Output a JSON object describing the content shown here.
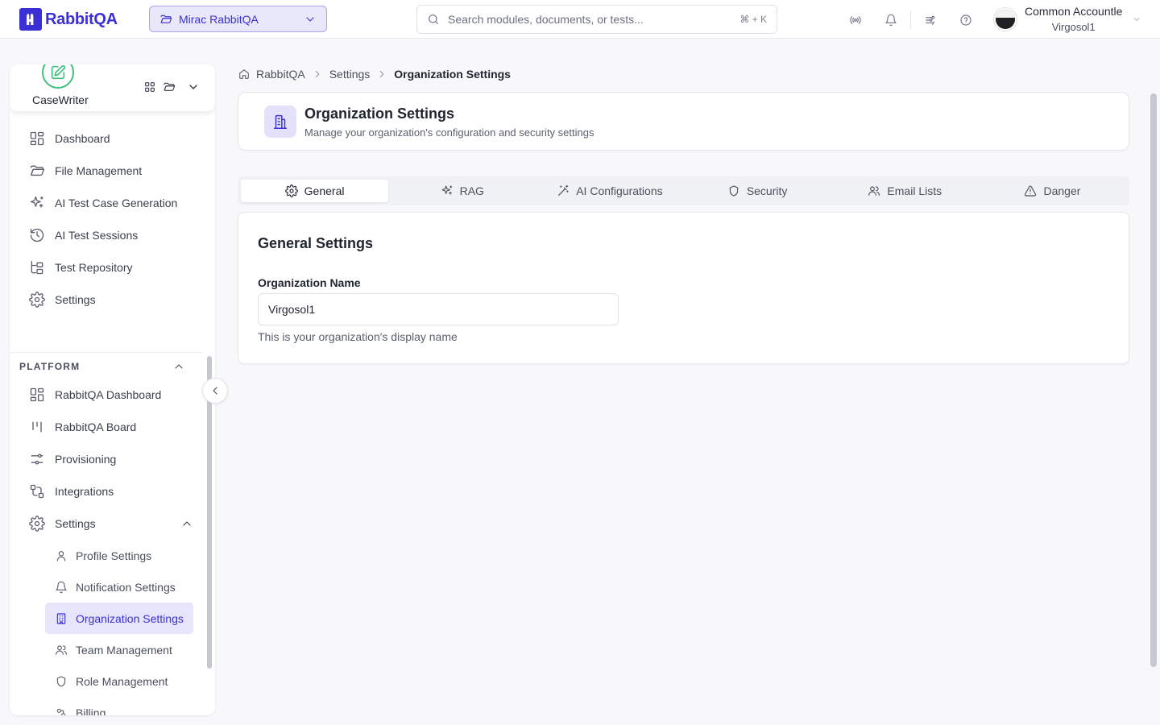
{
  "brand": {
    "name": "RabbitQA",
    "color": "#3b2fd6"
  },
  "topbar": {
    "project": "Mirac RabbitQA",
    "search_placeholder": "Search modules, documents, or tests...",
    "shortcut": "⌘ + K",
    "user_name": "Common Accountle",
    "user_org": "Virgosol1"
  },
  "sidebar": {
    "app_name": "CaseWriter",
    "nav": [
      {
        "label": "Dashboard",
        "icon": "dashboard-icon"
      },
      {
        "label": "File Management",
        "icon": "folder-icon"
      },
      {
        "label": "AI Test Case Generation",
        "icon": "sparkles-icon"
      },
      {
        "label": "AI Test Sessions",
        "icon": "history-icon"
      },
      {
        "label": "Test Repository",
        "icon": "tree-icon"
      },
      {
        "label": "Settings",
        "icon": "gear-icon"
      }
    ],
    "platform_heading": "PLATFORM",
    "platform": [
      {
        "label": "RabbitQA Dashboard",
        "icon": "dashboard-icon"
      },
      {
        "label": "RabbitQA Board",
        "icon": "kanban-icon"
      },
      {
        "label": "Provisioning",
        "icon": "sliders-icon"
      },
      {
        "label": "Integrations",
        "icon": "integration-icon"
      },
      {
        "label": "Settings",
        "icon": "gear-icon"
      }
    ],
    "settings_sub": [
      {
        "label": "Profile Settings",
        "icon": "user-icon"
      },
      {
        "label": "Notification Settings",
        "icon": "bell-icon"
      },
      {
        "label": "Organization Settings",
        "icon": "building-icon",
        "active": true
      },
      {
        "label": "Team Management",
        "icon": "users-icon"
      },
      {
        "label": "Role Management",
        "icon": "shield-icon"
      },
      {
        "label": "Billing",
        "icon": "billing-icon"
      }
    ]
  },
  "breadcrumb": {
    "home": "RabbitQA",
    "parent": "Settings",
    "current": "Organization Settings"
  },
  "header": {
    "title": "Organization Settings",
    "subtitle": "Manage your organization's configuration and security settings"
  },
  "tabs": [
    {
      "label": "General",
      "icon": "gear-icon",
      "active": true
    },
    {
      "label": "RAG",
      "icon": "sparkles-icon"
    },
    {
      "label": "AI Configurations",
      "icon": "wand-icon"
    },
    {
      "label": "Security",
      "icon": "shield-icon"
    },
    {
      "label": "Email Lists",
      "icon": "users-icon"
    },
    {
      "label": "Danger",
      "icon": "warning-icon"
    }
  ],
  "general": {
    "title": "General Settings",
    "field_label": "Organization Name",
    "field_value": "Virgosol1",
    "help": "This is your organization's display name"
  }
}
